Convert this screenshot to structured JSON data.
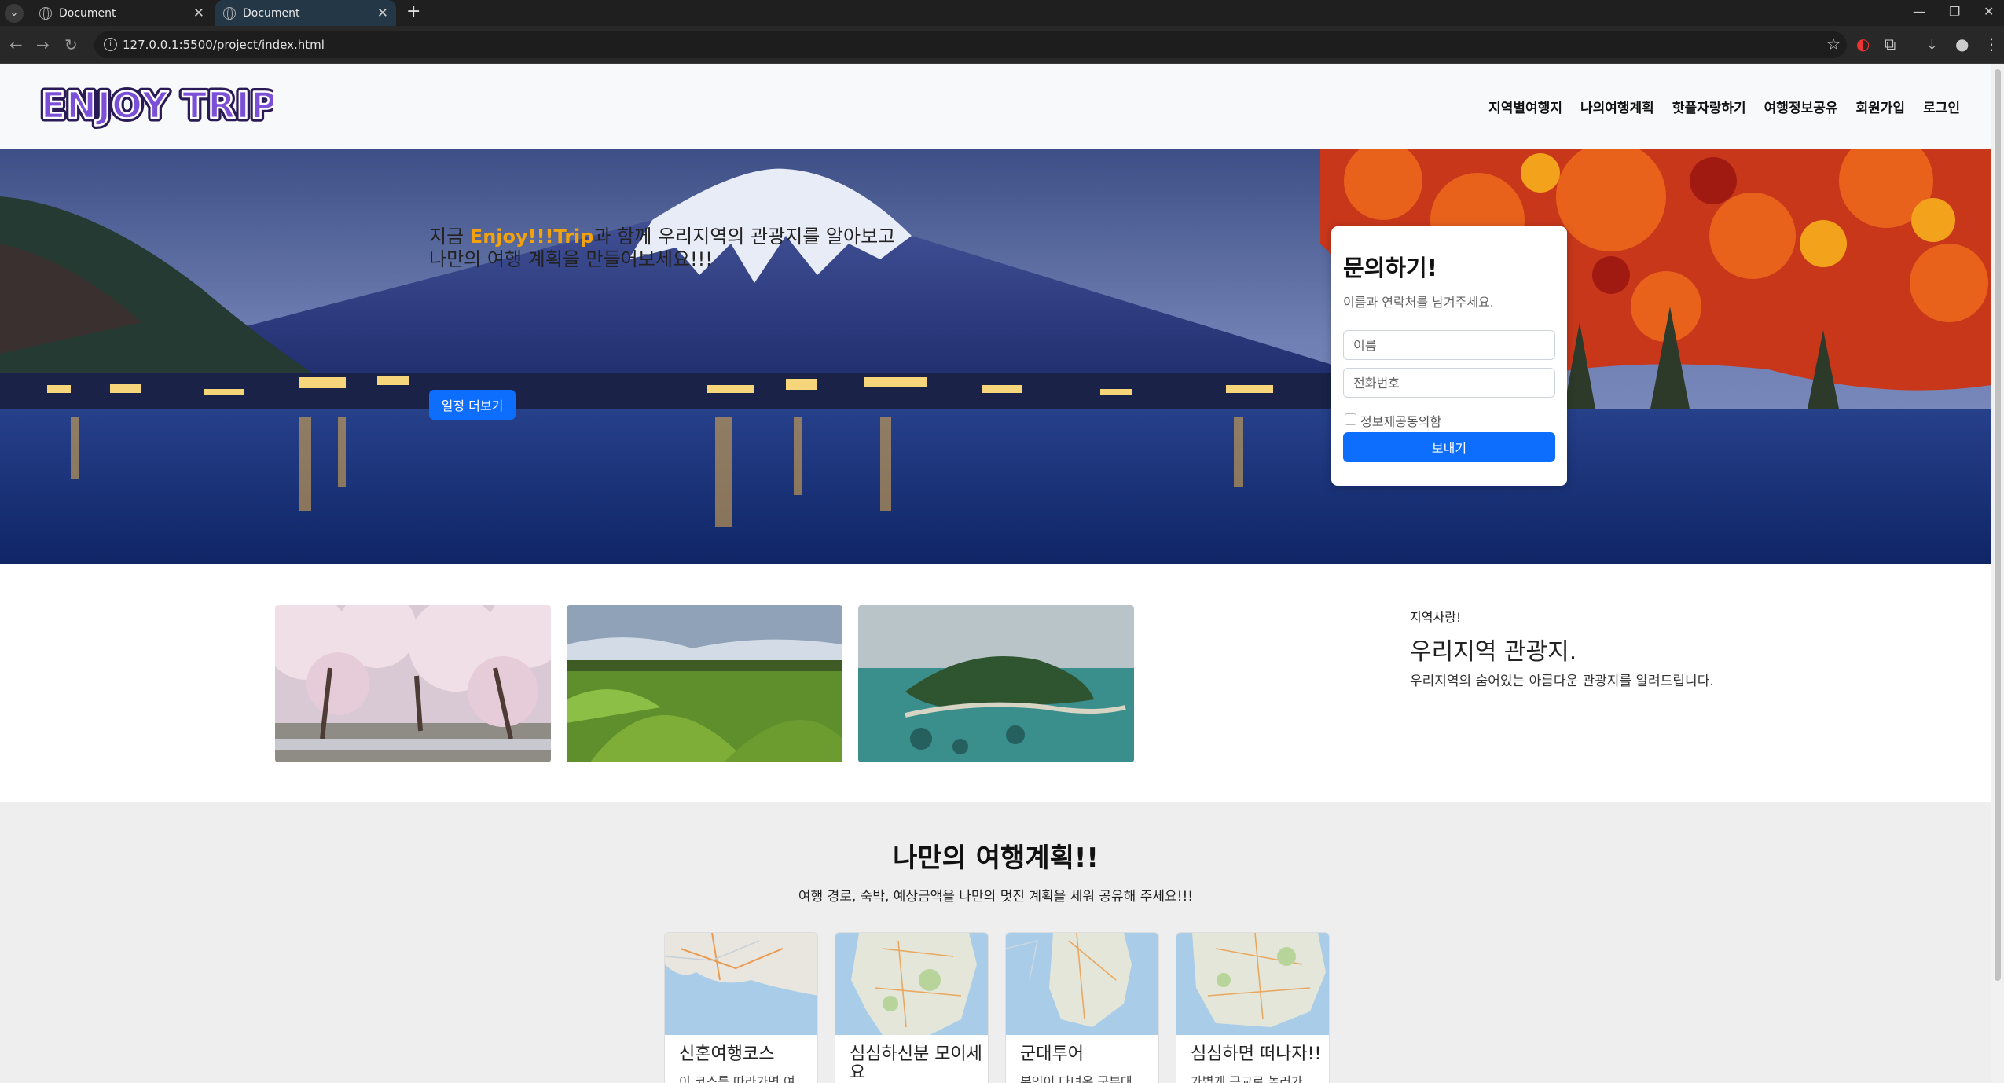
{
  "browser": {
    "tabs": [
      {
        "title": "Document",
        "active": false
      },
      {
        "title": "Document",
        "active": true
      }
    ],
    "url": "127.0.0.1:5500/project/index.html"
  },
  "header": {
    "logo_text": "ENJOY TRIP",
    "nav": [
      "지역별여행지",
      "나의여행계획",
      "핫플자랑하기",
      "여행정보공유",
      "회원가입",
      "로그인"
    ]
  },
  "hero": {
    "line1_prefix": "지금 ",
    "brand": "Enjoy!!!Trip",
    "line1_suffix": "과 함께 우리지역의 관광지를 알아보고",
    "line2": "나만의 여행 계획을 만들어보세요!!!",
    "button": "일정 더보기"
  },
  "contact": {
    "title": "문의하기!",
    "subtitle": "이름과 연락처를 남겨주세요.",
    "name_placeholder": "이름",
    "phone_placeholder": "전화번호",
    "agree_label": "정보제공동의함",
    "submit": "보내기"
  },
  "region": {
    "tag": "지역사랑!",
    "title": "우리지역 관광지.",
    "desc": "우리지역의 숨어있는 아름다운 관광지를 알려드립니다."
  },
  "plans": {
    "title": "나만의 여행계획!!",
    "desc": "여행 경로, 숙박, 예상금액을 나만의 멋진 계획을 세워 공유해 주세요!!!",
    "cards": [
      {
        "title": "신혼여행코스",
        "text": "이 코스를 따라가면 여"
      },
      {
        "title": "심심하신분 모이세요",
        "text": ""
      },
      {
        "title": "군대투어",
        "text": "본인이 다녀온 군부대"
      },
      {
        "title": "심심하면 떠나자!!",
        "text": "가볍게 근교로 놀러가"
      }
    ]
  },
  "colors": {
    "primary": "#0d6efd",
    "brand_accent": "#f2a20c",
    "logo_fill": "#6b3fc4"
  }
}
